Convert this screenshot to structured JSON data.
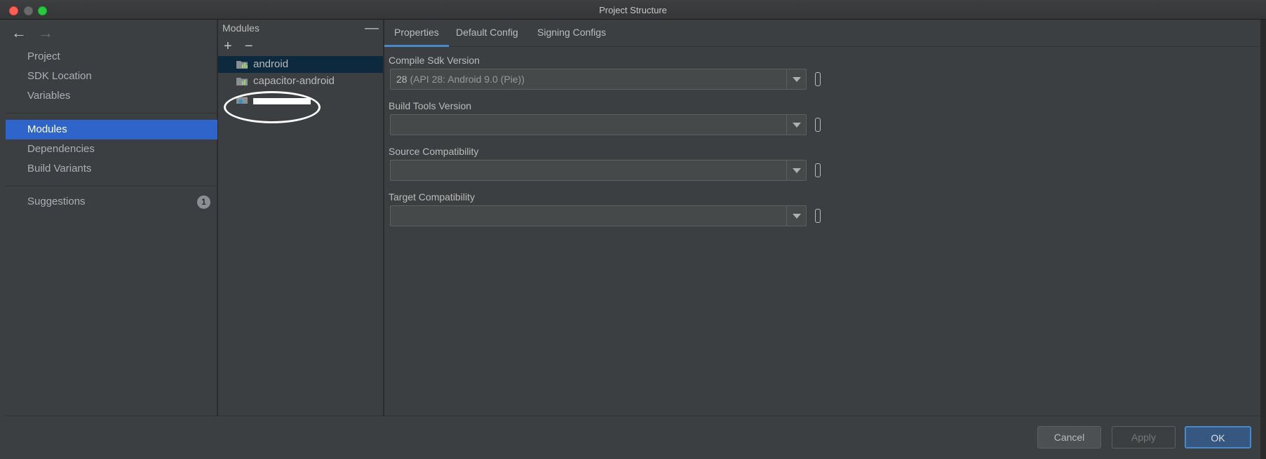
{
  "window": {
    "title": "Project Structure"
  },
  "nav": {
    "back": "←",
    "forward": "→"
  },
  "sidebar": {
    "items": [
      {
        "label": "Project"
      },
      {
        "label": "SDK Location"
      },
      {
        "label": "Variables"
      },
      {
        "label": "Modules",
        "active": true
      },
      {
        "label": "Dependencies"
      },
      {
        "label": "Build Variants"
      },
      {
        "label": "Suggestions",
        "badge": "1"
      }
    ]
  },
  "modules": {
    "header": "Modules",
    "collapse_glyph": "—",
    "add_glyph": "+",
    "remove_glyph": "−",
    "items": [
      {
        "label": "android",
        "selected": true
      },
      {
        "label": "capacitor-android"
      }
    ]
  },
  "tabs": [
    {
      "label": "Properties",
      "active": true
    },
    {
      "label": "Default Config"
    },
    {
      "label": "Signing Configs"
    }
  ],
  "properties": {
    "compile_sdk": {
      "label": "Compile Sdk Version",
      "value": "28",
      "value_detail": "(API 28: Android 9.0 (Pie))"
    },
    "build_tools": {
      "label": "Build Tools Version",
      "value": ""
    },
    "source_compat": {
      "label": "Source Compatibility",
      "value": ""
    },
    "target_compat": {
      "label": "Target Compatibility",
      "value": ""
    }
  },
  "footer": {
    "cancel": "Cancel",
    "apply": "Apply",
    "ok": "OK"
  },
  "colors": {
    "accent": "#2f65ca",
    "ok_border": "#4a88c7",
    "selection": "#0d293e"
  }
}
